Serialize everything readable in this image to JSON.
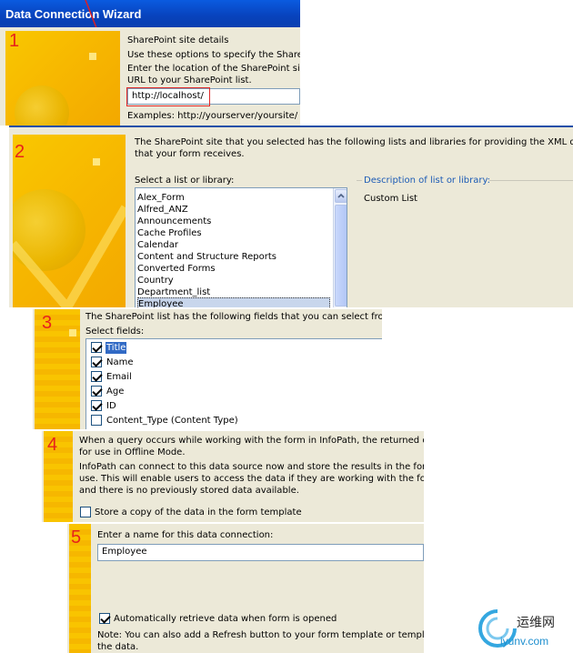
{
  "wizard": {
    "title": "Data Connection Wizard"
  },
  "step1": {
    "number": "1",
    "heading": "SharePoint site details",
    "line1": "Use these options to specify the ShareP",
    "line2": "Enter the location of the SharePoint site",
    "line3": "URL to your SharePoint list.",
    "url_value": "http://localhost/",
    "examples": "Examples: http://yourserver/yoursite/ o"
  },
  "step2": {
    "number": "2",
    "desc_line1": "The SharePoint site that you selected has the following lists and libraries for providing the XML data",
    "desc_line2": "that your form receives.",
    "list_label": "Select a list or library:",
    "items": [
      "Alex_Form",
      "Alfred_ANZ",
      "Announcements",
      "Cache Profiles",
      "Calendar",
      "Content and Structure Reports",
      "Converted Forms",
      "Country",
      "Department_list",
      "Employee"
    ],
    "selected_item": "Employee",
    "description_label": "Description of list or library:",
    "description_value": "Custom List"
  },
  "step3": {
    "number": "3",
    "desc": "The SharePoint list has the following fields that you can select from.",
    "label": "Select fields:",
    "fields": [
      {
        "label": "Title",
        "checked": true
      },
      {
        "label": "Name",
        "checked": true
      },
      {
        "label": "Email",
        "checked": true
      },
      {
        "label": "Age",
        "checked": true
      },
      {
        "label": "ID",
        "checked": true
      },
      {
        "label": "Content_Type (Content Type)",
        "checked": false
      }
    ]
  },
  "step4": {
    "number": "4",
    "line1": "When a query occurs while working with the form in InfoPath, the returned dat",
    "line2": "for use in Offline Mode.",
    "line3": "InfoPath can connect to this data source now and store the results in the form",
    "line4": "use. This will enable users to access the data if they are working with the form",
    "line5": "and there is no previously stored data available.",
    "store_copy_label": "Store a copy of the data in the form template",
    "store_copy_checked": false
  },
  "step5": {
    "number": "5",
    "name_label": "Enter a name for this data connection:",
    "name_value": "Employee",
    "auto_retrieve_label": "Automatically retrieve data when form is opened",
    "auto_retrieve_checked": true,
    "note_line1": "Note: You can also add a Refresh button to your form template or template",
    "note_line2": "the data."
  },
  "watermark": {
    "text_cn": "运维网",
    "text_en": "iyunv.com"
  }
}
